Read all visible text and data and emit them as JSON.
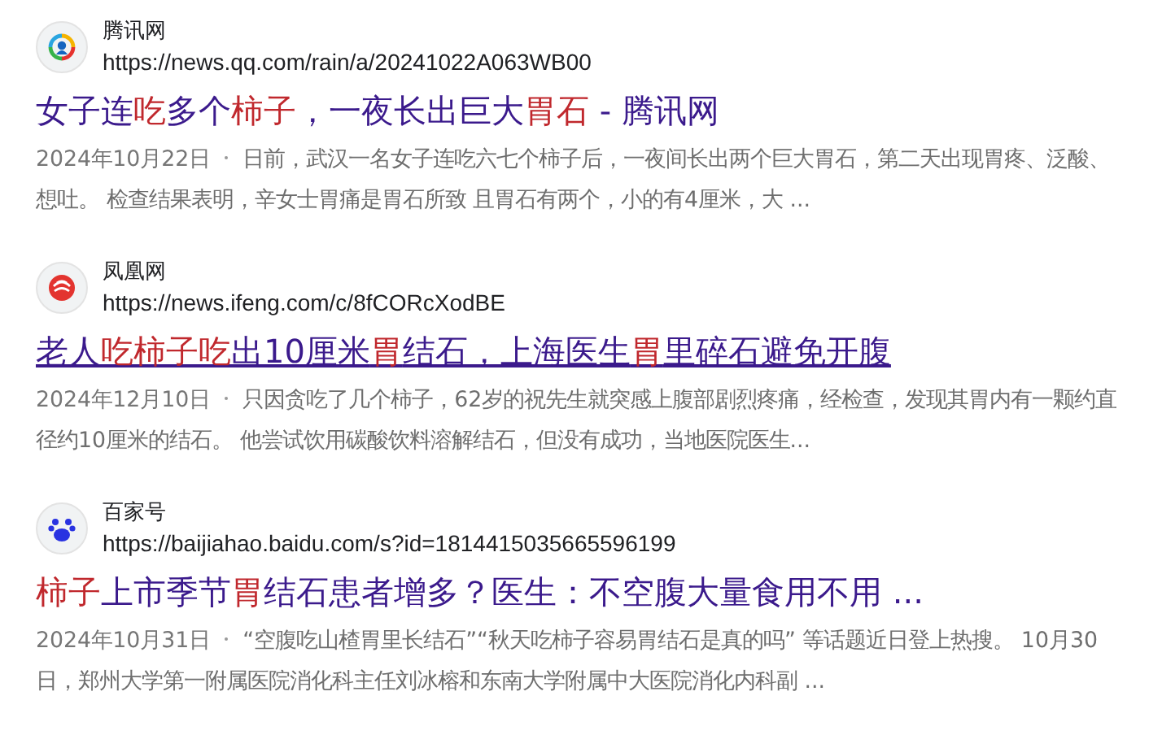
{
  "results": [
    {
      "kind": "tencent",
      "site": "腾讯网",
      "url": "https://news.qq.com/rain/a/20241022A063WB00",
      "underlined": false,
      "title": [
        {
          "text": "女子连",
          "highlight": false
        },
        {
          "text": "吃",
          "highlight": true
        },
        {
          "text": "多个",
          "highlight": false
        },
        {
          "text": "柿子",
          "highlight": true
        },
        {
          "text": "，一夜长出巨大",
          "highlight": false
        },
        {
          "text": "胃石",
          "highlight": true
        },
        {
          "text": " - 腾讯网",
          "highlight": false
        }
      ],
      "date": "2024年10月22日",
      "snippet": "日前，武汉一名女子连吃六七个柿子后，一夜间长出两个巨大胃石，第二天出现胃疼、泛酸、想吐。 检查结果表明，辛女士胃痛是胃石所致 且胃石有两个，小的有4厘米，大 ..."
    },
    {
      "kind": "ifeng",
      "site": "凤凰网",
      "url": "https://news.ifeng.com/c/8fCORcXodBE",
      "underlined": true,
      "title": [
        {
          "text": "老人",
          "highlight": false
        },
        {
          "text": "吃柿子吃",
          "highlight": true
        },
        {
          "text": "出10厘米",
          "highlight": false
        },
        {
          "text": "胃",
          "highlight": true
        },
        {
          "text": "结石，上海医生",
          "highlight": false
        },
        {
          "text": "胃",
          "highlight": true
        },
        {
          "text": "里碎石避免开腹",
          "highlight": false
        }
      ],
      "date": "2024年12月10日",
      "snippet": "只因贪吃了几个柿子，62岁的祝先生就突感上腹部剧烈疼痛，经检查，发现其胃内有一颗约直径约10厘米的结石。 他尝试饮用碳酸饮料溶解结石，但没有成功，当地医院医生..."
    },
    {
      "kind": "baidu",
      "site": "百家号",
      "url": "https://baijiahao.baidu.com/s?id=1814415035665596199",
      "underlined": false,
      "title": [
        {
          "text": "柿子",
          "highlight": true
        },
        {
          "text": "上市季节",
          "highlight": false
        },
        {
          "text": "胃",
          "highlight": true
        },
        {
          "text": "结石患者增多？医生：不空腹大量食用不用 ...",
          "highlight": false
        }
      ],
      "date": "2024年10月31日",
      "snippet": "“空腹吃山楂胃里长结石”“秋天吃柿子容易胃结石是真的吗” 等话题近日登上热搜。 10月30日，郑州大学第一附属医院消化科主任刘冰榕和东南大学附属中大医院消化内科副 ..."
    }
  ]
}
